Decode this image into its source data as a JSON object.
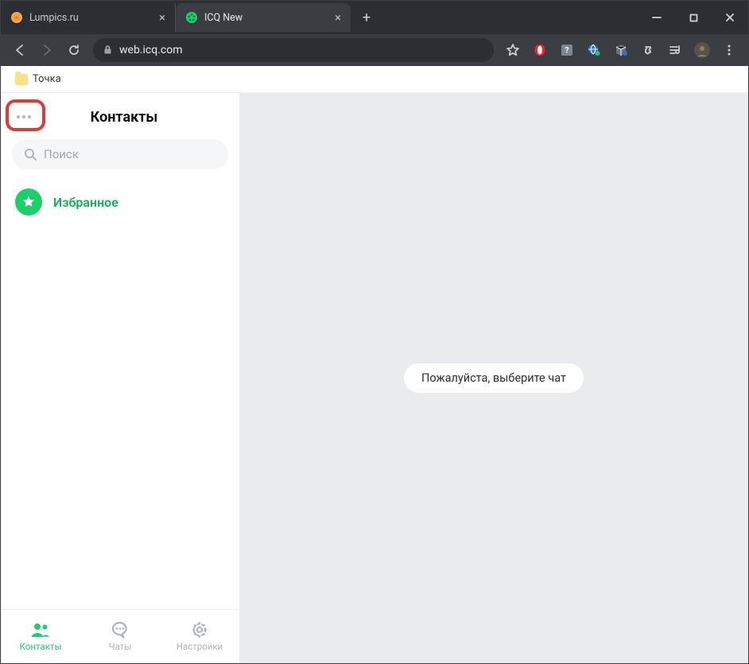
{
  "window": {
    "tabs": [
      {
        "title": "Lumpics.ru",
        "active": false
      },
      {
        "title": "ICQ New",
        "active": true
      }
    ]
  },
  "toolbar": {
    "url": "web.icq.com"
  },
  "bookmarks": {
    "items": [
      {
        "label": "Точка"
      }
    ]
  },
  "sidebar": {
    "title": "Контакты",
    "search_placeholder": "Поиск",
    "contacts": [
      {
        "label": "Избранное",
        "kind": "favorites"
      }
    ]
  },
  "bottom_nav": {
    "items": [
      {
        "label": "Контакты",
        "active": true
      },
      {
        "label": "Чаты",
        "active": false
      },
      {
        "label": "Настройки",
        "active": false
      }
    ]
  },
  "main": {
    "placeholder": "Пожалуйста, выберите чат"
  }
}
